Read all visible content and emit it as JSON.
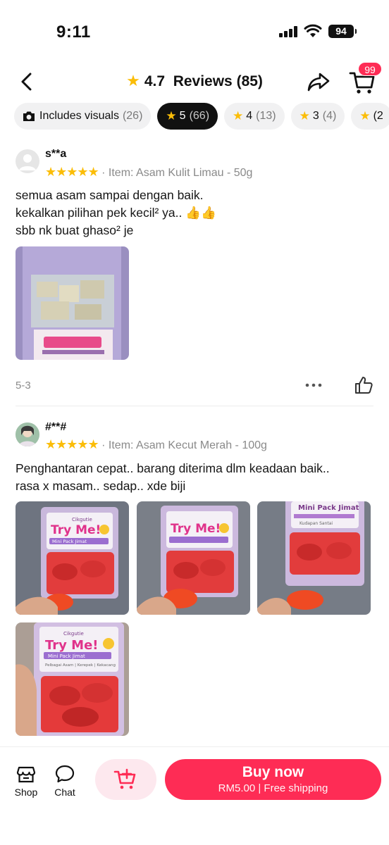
{
  "status_bar": {
    "time": "9:11",
    "battery": "94"
  },
  "header": {
    "rating": "4.7",
    "reviews_label": "Reviews (85)",
    "cart_badge": "99",
    "star_color": "#fbbd08"
  },
  "filters": [
    {
      "label": "Includes visuals",
      "count": "(26)",
      "icon": "camera-icon",
      "active": false
    },
    {
      "label": "5",
      "count": "(66)",
      "icon": "star-icon",
      "active": true
    },
    {
      "label": "4",
      "count": "(13)",
      "icon": "star-icon",
      "active": false
    },
    {
      "label": "3",
      "count": "(4)",
      "icon": "star-icon",
      "active": false
    },
    {
      "label": "(2",
      "count": "",
      "icon": "star-icon",
      "active": false
    }
  ],
  "reviews": [
    {
      "username": "s**a",
      "stars": "★★★★★",
      "item": "· Item: Asam Kulit Limau - 50g",
      "lines": [
        "semua asam sampai dengan baik.",
        "kekalkan pilihan pek kecil² ya.. 👍👍",
        "sbb nk buat ghaso² je"
      ],
      "date": "5-3"
    },
    {
      "username": "#**#",
      "stars": "★★★★★",
      "item": "· Item: Asam Kecut Merah - 100g",
      "lines": [
        "Penghantaran cepat.. barang diterima dlm keadaan baik..",
        "rasa x masam.. sedap.. xde biji"
      ],
      "photo_brand": "Cikgutie",
      "photo_title": "Try Me!",
      "photo_subtitle": "Mini Pack Jimat",
      "photo_tagline": "Pelbagai Asam | Kerepek | Kekacang",
      "photo_note": "Kudapan Santai"
    }
  ],
  "bottom_bar": {
    "shop_label": "Shop",
    "chat_label": "Chat",
    "buy_label": "Buy now",
    "buy_sub": "RM5.00 | Free shipping",
    "accent": "#fe2c55"
  }
}
